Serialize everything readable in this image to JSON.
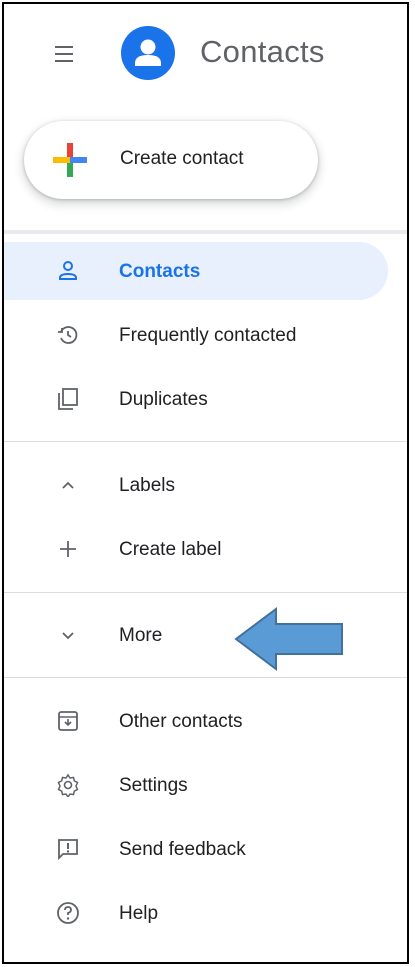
{
  "header": {
    "menu_icon": "hamburger-menu-icon",
    "app_title": "Contacts",
    "avatar_icon": "contacts-avatar-icon"
  },
  "create_contact": {
    "label": "Create contact",
    "icon": "multicolor-plus-icon"
  },
  "nav": {
    "contacts": "Contacts",
    "frequently_contacted": "Frequently contacted",
    "duplicates": "Duplicates"
  },
  "labels": {
    "labels_header": "Labels",
    "create_label": "Create label"
  },
  "more": {
    "label": "More"
  },
  "footer": {
    "other_contacts": "Other contacts",
    "settings": "Settings",
    "send_feedback": "Send feedback",
    "help": "Help"
  },
  "colors": {
    "accent": "#1a73e8",
    "active_bg": "#e8f0fe",
    "icon_gray": "#5f6368",
    "annotation_arrow": "#5b9bd5"
  }
}
